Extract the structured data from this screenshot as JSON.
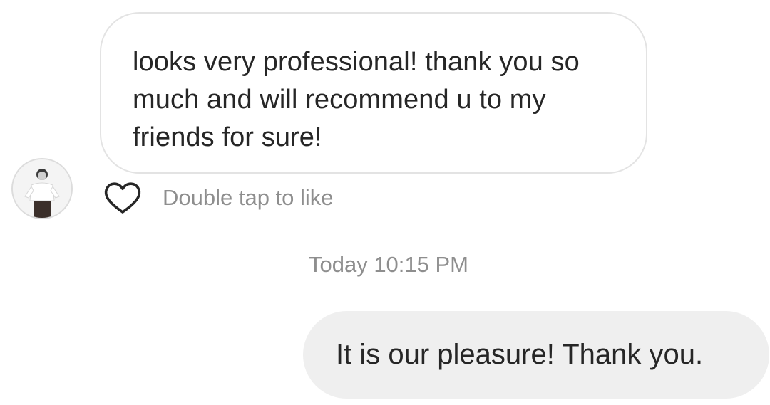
{
  "thread": {
    "received_message": {
      "text": "looks very professional! thank you so much and will recommend u to my friends for sure!",
      "like_hint": "Double tap to like"
    },
    "timestamp": "Today 10:15 PM",
    "sent_message": {
      "text": "It is our pleasure! Thank you."
    }
  },
  "icons": {
    "like": "heart-outline-icon",
    "avatar": "user-avatar"
  },
  "colors": {
    "text_primary": "#262626",
    "text_secondary": "#8e8e8e",
    "received_bubble_border": "#e3e3e3",
    "sent_bubble_fill": "#efefef"
  }
}
